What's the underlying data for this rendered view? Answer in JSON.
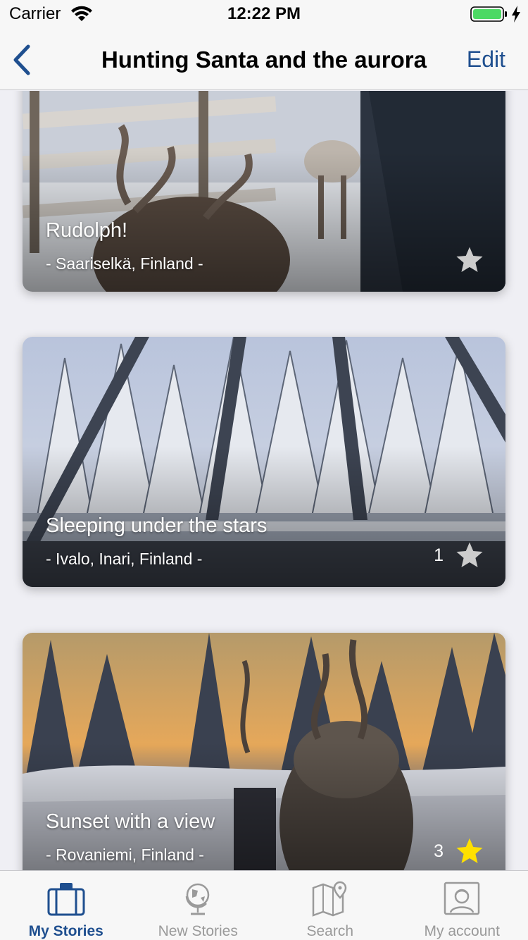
{
  "status": {
    "carrier": "Carrier",
    "time": "12:22 PM"
  },
  "nav": {
    "title": "Hunting Santa and the aurora",
    "edit_label": "Edit",
    "back_icon": "chevron-left-icon"
  },
  "stories": [
    {
      "title": "Rudolph!",
      "location": "- Saariselkä, Finland -",
      "star_count": "",
      "starred": false
    },
    {
      "title": "Sleeping under the stars",
      "location": "- Ivalo, Inari, Finland -",
      "star_count": "1",
      "starred": false
    },
    {
      "title": "Sunset with a view",
      "location": "- Rovaniemi, Finland -",
      "star_count": "3",
      "starred": true
    }
  ],
  "tabs": [
    {
      "label": "My Stories",
      "icon": "suitcase-icon",
      "active": true
    },
    {
      "label": "New Stories",
      "icon": "globe-icon",
      "active": false
    },
    {
      "label": "Search",
      "icon": "map-icon",
      "active": false
    },
    {
      "label": "My account",
      "icon": "user-portrait-icon",
      "active": false
    }
  ],
  "colors": {
    "accent": "#1f4f8f",
    "star_active": "#ffe000",
    "star_inactive": "#cccccc",
    "battery": "#4cd964"
  }
}
